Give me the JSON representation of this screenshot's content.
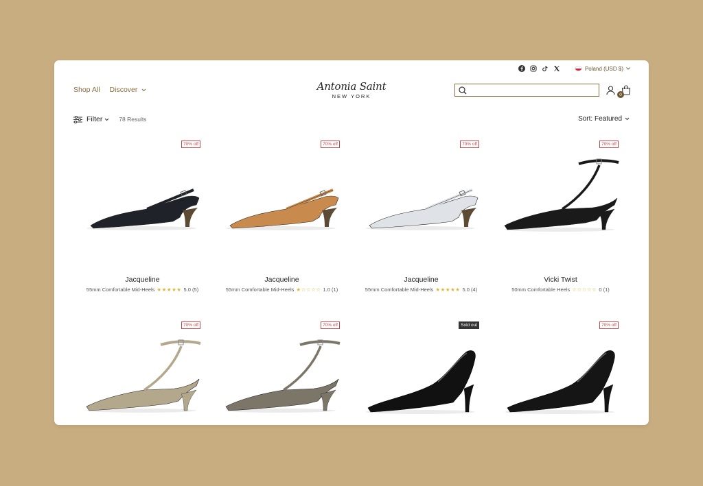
{
  "topbar": {
    "socials": [
      "facebook-icon",
      "instagram-icon",
      "tiktok-icon",
      "x-icon"
    ],
    "region": "Poland (USD $)"
  },
  "nav": {
    "shop_all": "Shop All",
    "discover": "Discover"
  },
  "logo": {
    "script": "Antonia Saint",
    "sub": "NEW YORK"
  },
  "search": {
    "placeholder": ""
  },
  "cart": {
    "count": "0"
  },
  "filter": {
    "label": "Filter",
    "results": "78 Results"
  },
  "sort": {
    "label": "Sort: Featured"
  },
  "colors": {
    "accent": "#8a6d3b",
    "sale": "#c14848",
    "background": "#c8ad80",
    "star": "#d8b83a"
  },
  "products": [
    {
      "badge": "70% off",
      "sold_out": false,
      "name": "Jacqueline",
      "desc": "55mm Comfortable Mid-Heels",
      "rating": 5,
      "rating_text": "5.0 (5)",
      "color": "#1f2228",
      "style": "slingback"
    },
    {
      "badge": "70% off",
      "sold_out": false,
      "name": "Jacqueline",
      "desc": "55mm Comfortable Mid-Heels",
      "rating": 1,
      "rating_text": "1.0 (1)",
      "color": "#c98a4e",
      "style": "slingback"
    },
    {
      "badge": "70% off",
      "sold_out": false,
      "name": "Jacqueline",
      "desc": "55mm Comfortable Mid-Heels",
      "rating": 5,
      "rating_text": "5.0 (4)",
      "color": "#dfe3e8",
      "style": "slingback"
    },
    {
      "badge": "70% off",
      "sold_out": false,
      "name": "Vicki Twist",
      "desc": "50mm Comfortable Heels",
      "rating": 0,
      "rating_text": "0 (1)",
      "color": "#1a1a1a",
      "style": "ankle"
    },
    {
      "badge": "70% off",
      "sold_out": false,
      "name": "",
      "desc": "",
      "rating": null,
      "rating_text": "",
      "color": "#b3a78c",
      "style": "ankle"
    },
    {
      "badge": "70% off",
      "sold_out": false,
      "name": "",
      "desc": "",
      "rating": null,
      "rating_text": "",
      "color": "#7c7669",
      "style": "ankle"
    },
    {
      "badge": "Sold out",
      "sold_out": true,
      "name": "",
      "desc": "",
      "rating": null,
      "rating_text": "",
      "color": "#111111",
      "style": "pump"
    },
    {
      "badge": "70% off",
      "sold_out": false,
      "name": "",
      "desc": "",
      "rating": null,
      "rating_text": "",
      "color": "#151515",
      "style": "pump"
    }
  ]
}
